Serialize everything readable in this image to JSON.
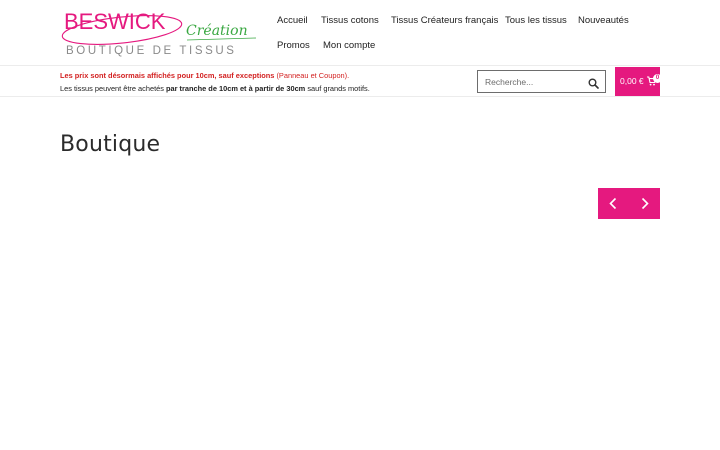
{
  "colors": {
    "accent": "#e5197f",
    "alert_red": "#d32222"
  },
  "logo": {
    "brand": "BESWICK",
    "script": "Création",
    "tagline": "BOUTIQUE DE TISSUS"
  },
  "nav": {
    "items": [
      "Accueil",
      "Tissus cotons",
      "Tissus Créateurs français",
      "Tous les tissus",
      "Nouveautés",
      "Promos",
      "Mon compte"
    ]
  },
  "notice": {
    "line1_bold": "Les prix sont désormais affichés pour 10cm, sauf exceptions",
    "line1_rest": " (Panneau et Coupon).",
    "line2_a": "Les tissus peuvent être achetés ",
    "line2_bold": "par tranche de 10cm et à partir de 30cm",
    "line2_b": " sauf grands motifs."
  },
  "search": {
    "placeholder": "Recherche...",
    "icon": "search-icon"
  },
  "cart": {
    "amount": "0,00 €",
    "count": "0",
    "icon": "cart-icon"
  },
  "page": {
    "title": "Boutique"
  },
  "slider": {
    "prev_icon": "chevron-left-icon",
    "next_icon": "chevron-right-icon"
  }
}
